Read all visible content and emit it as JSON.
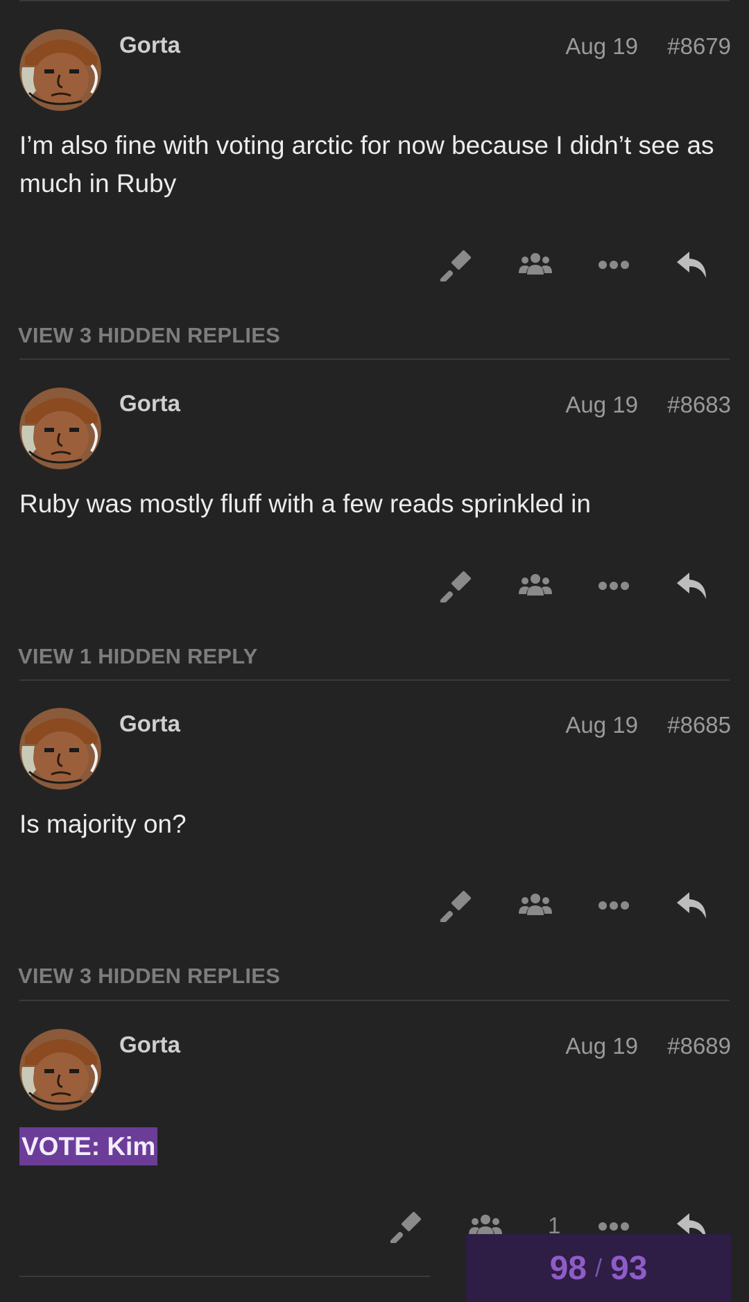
{
  "colors": {
    "background": "#232323",
    "vote_highlight": "#6b3d99",
    "progress_bg": "#2e1d44",
    "progress_text": "#8f5cc7"
  },
  "posts": [
    {
      "author": "Gorta",
      "date": "Aug 19",
      "number": "#8679",
      "text": "I’m also fine with voting arctic for now because I didn’t see as much in Ruby",
      "hidden_replies": "VIEW 3 HIDDEN REPLIES"
    },
    {
      "author": "Gorta",
      "date": "Aug 19",
      "number": "#8683",
      "text": "Ruby was mostly fluff with a few reads sprinkled in",
      "hidden_replies": "VIEW 1 HIDDEN REPLY"
    },
    {
      "author": "Gorta",
      "date": "Aug 19",
      "number": "#8685",
      "text": "Is majority on?",
      "hidden_replies": "VIEW 3 HIDDEN REPLIES"
    },
    {
      "author": "Gorta",
      "date": "Aug 19",
      "number": "#8689",
      "vote_text": "VOTE: Kim",
      "like_count": "1"
    }
  ],
  "icons": {
    "gavel": "gavel-icon",
    "group": "users-icon",
    "more": "ellipsis-icon",
    "reply": "reply-icon"
  },
  "progress": {
    "current": "98",
    "separator": "/",
    "total": "93"
  }
}
